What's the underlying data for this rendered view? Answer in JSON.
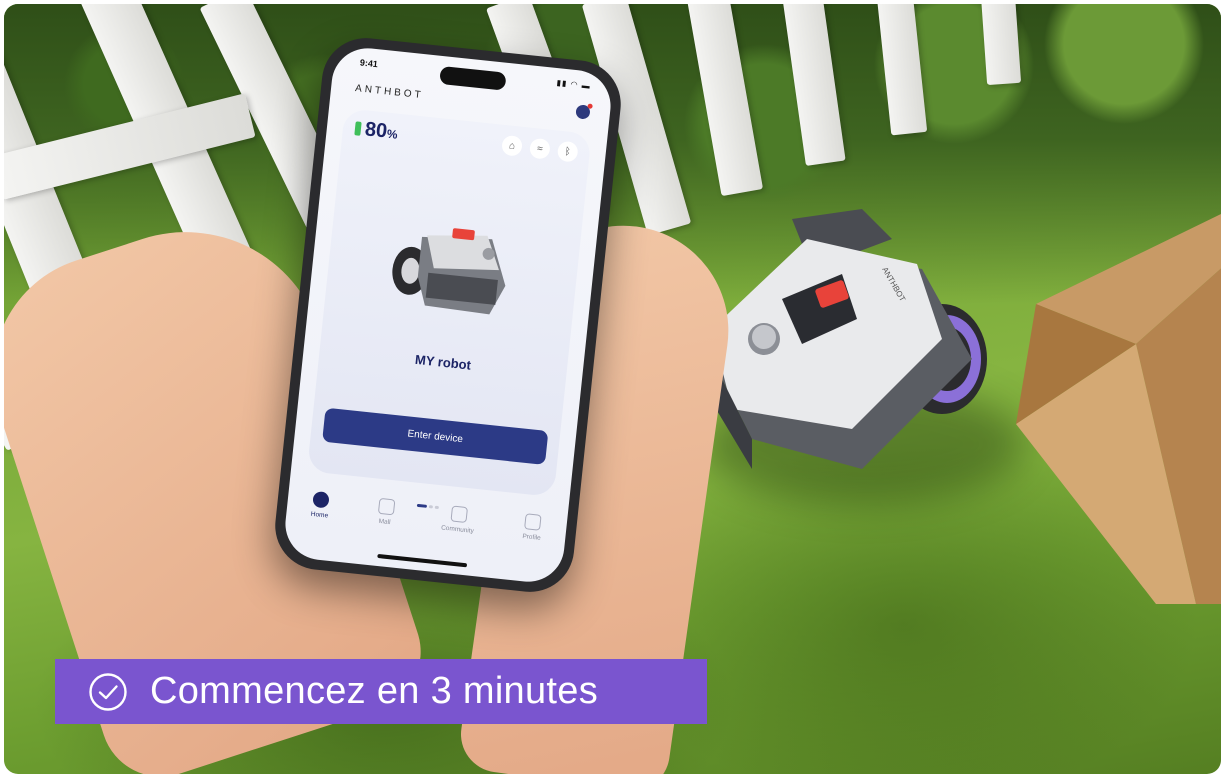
{
  "phone": {
    "status_time": "9:41",
    "brand": "ANTHBOT",
    "battery_value": "80",
    "battery_unit": "%",
    "robot_name": "MY robot",
    "enter_button_label": "Enter device",
    "tabs": [
      {
        "label": "Home",
        "active": true
      },
      {
        "label": "Mall",
        "active": false
      },
      {
        "label": "Community",
        "active": false
      },
      {
        "label": "Profile",
        "active": false
      }
    ]
  },
  "mower": {
    "brand": "ANTHBOT"
  },
  "banner": {
    "text": "Commencez en 3 minutes",
    "icon": "check-circle-icon",
    "background": "#7a55cf"
  }
}
